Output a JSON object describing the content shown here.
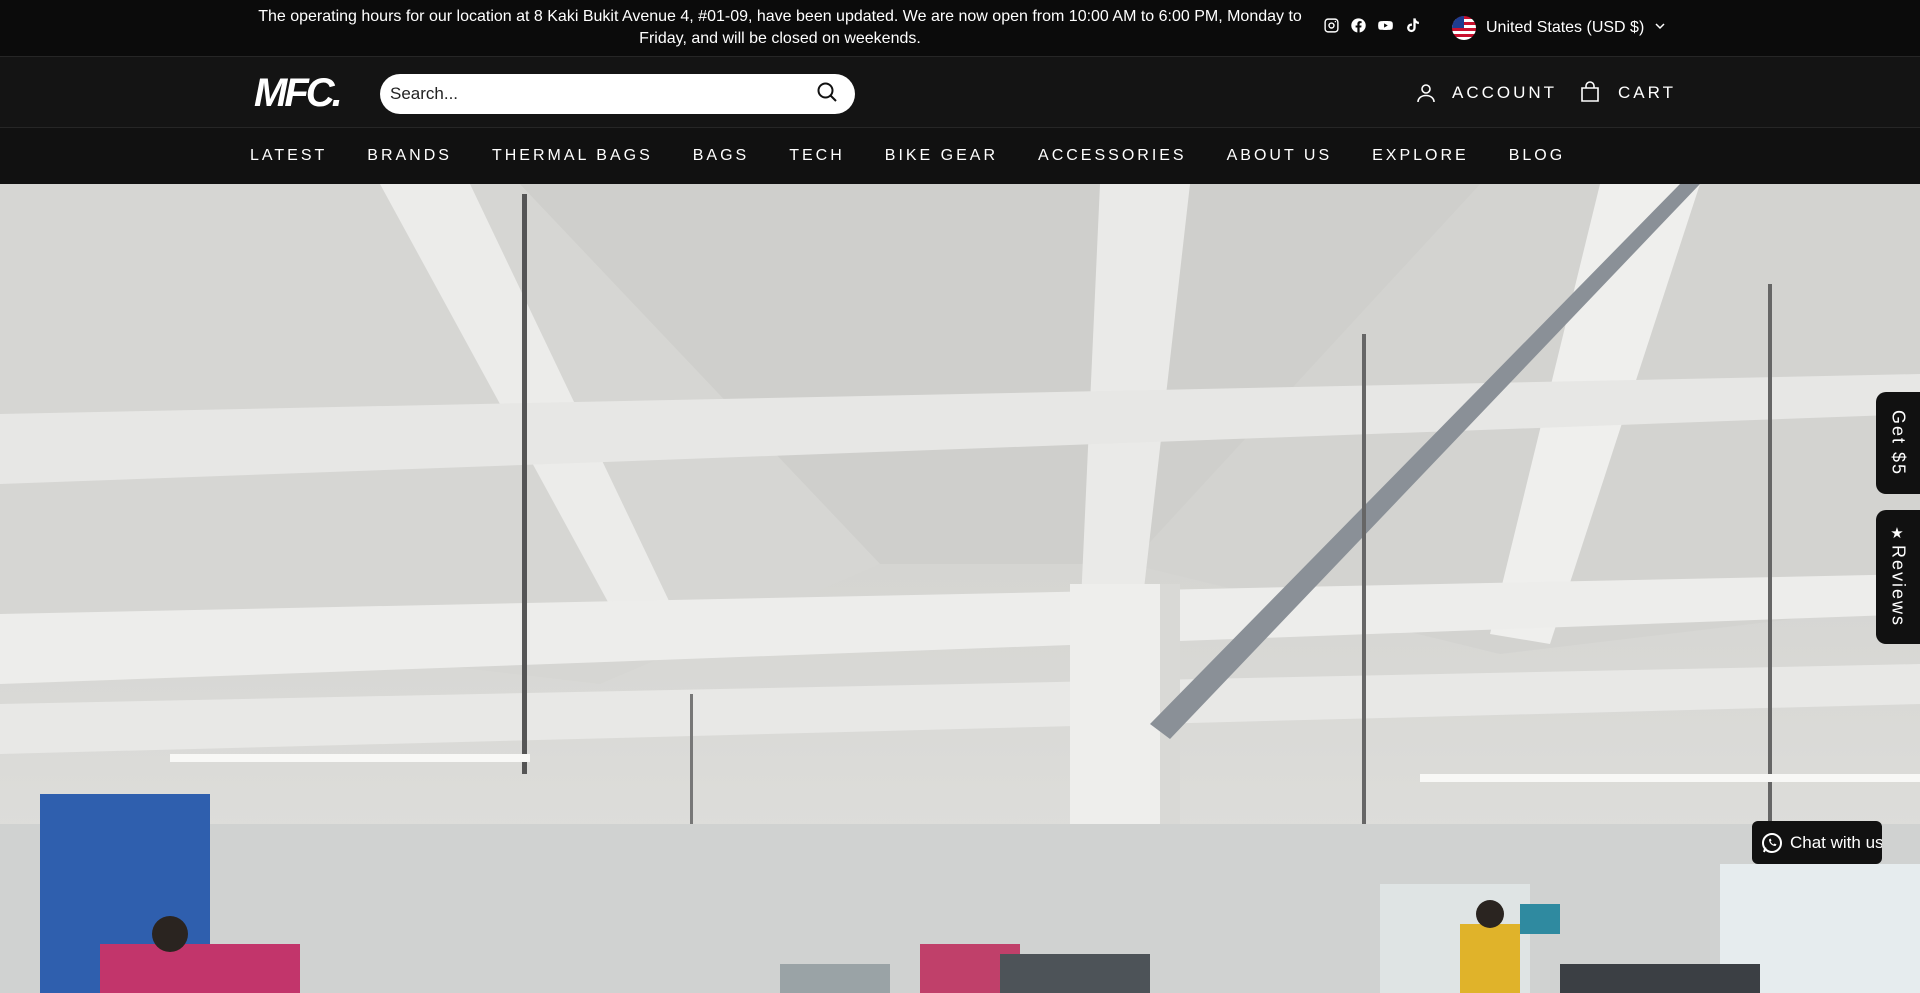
{
  "announcement": {
    "text": "The operating hours for our location at 8 Kaki Bukit Avenue 4, #01-09, have been updated. We are now open from 10:00 AM to 6:00 PM, Monday to Friday, and will be closed on weekends."
  },
  "socials": [
    {
      "icon": "instagram-icon"
    },
    {
      "icon": "facebook-icon"
    },
    {
      "icon": "youtube-icon"
    },
    {
      "icon": "tiktok-icon"
    }
  ],
  "currency": {
    "label": "United States (USD $)"
  },
  "header": {
    "logo": "MFC.",
    "search_placeholder": "Search...",
    "account_label": "ACCOUNT",
    "cart_label": "CART"
  },
  "nav": {
    "items": [
      "LATEST",
      "BRANDS",
      "THERMAL BAGS",
      "BAGS",
      "TECH",
      "BIKE GEAR",
      "ACCESSORIES",
      "ABOUT US",
      "EXPLORE",
      "BLOG"
    ]
  },
  "side_tabs": {
    "get": "Get $5",
    "reviews": "Reviews"
  },
  "chat": {
    "label": "Chat with us"
  },
  "colors": {
    "bar_bg": "#0b0b0b",
    "header_bg": "#141414",
    "text": "#ffffff"
  }
}
